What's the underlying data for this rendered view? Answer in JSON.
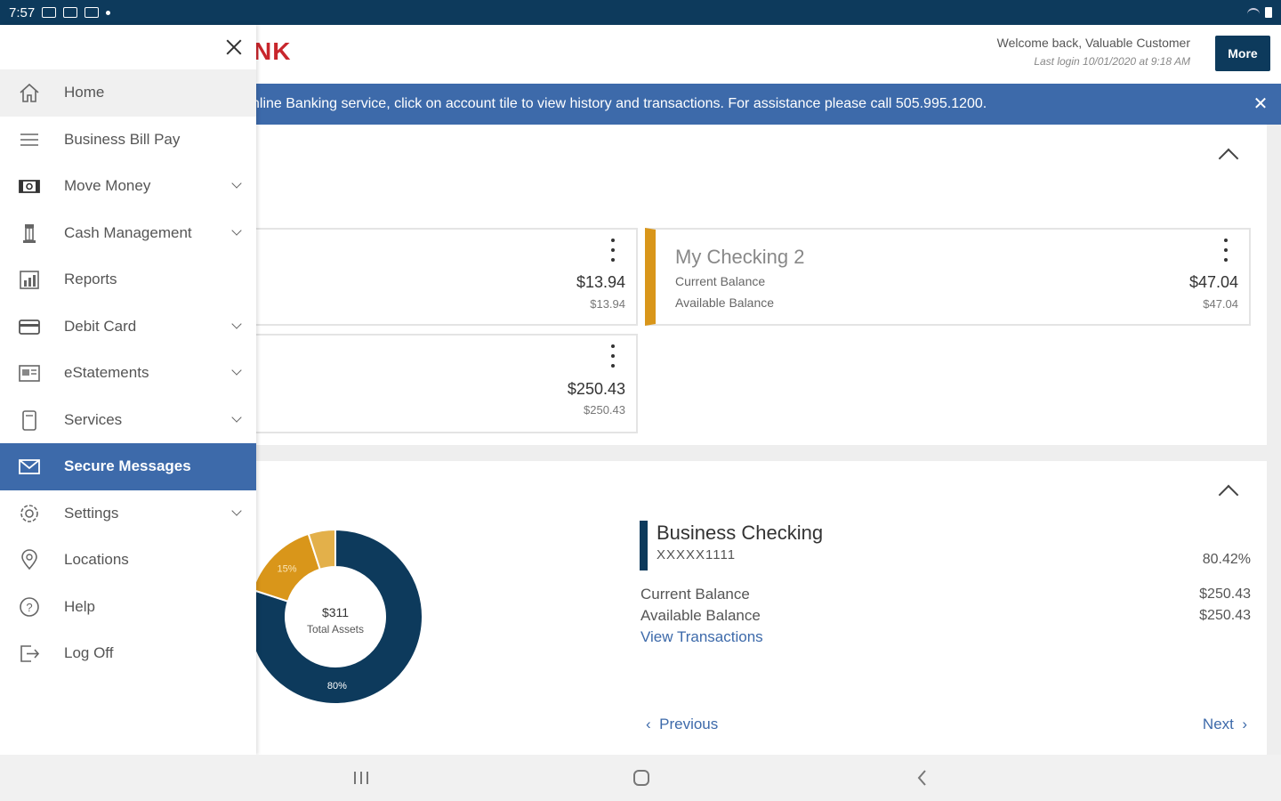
{
  "status_bar": {
    "time": "7:57"
  },
  "header": {
    "logo_text": "NK",
    "welcome": "Welcome back, Valuable Customer",
    "last_login": "Last login 10/01/2020 at 9:18 AM",
    "more_label": "More"
  },
  "banner": {
    "message": "nline Banking service, click on account tile to view history and transactions. For assistance please call 505.995.1200.",
    "close_glyph": "✕"
  },
  "accounts": {
    "tile1": {
      "current": "$13.94",
      "available": "$13.94"
    },
    "tile2": {
      "name": "My Checking 2",
      "current_label": "Current Balance",
      "available_label": "Available Balance",
      "current": "$47.04",
      "available": "$47.04"
    },
    "tile3": {
      "current": "$250.43",
      "available": "$250.43"
    }
  },
  "assets": {
    "total_value": "$311",
    "total_label": "Total Assets",
    "segments": [
      {
        "label": "80%",
        "percent": 80,
        "color": "#0d3a5c"
      },
      {
        "label": "15%",
        "percent": 15,
        "color": "#d9961a"
      },
      {
        "label": "",
        "percent": 5,
        "color": "#e3b04a"
      }
    ],
    "detail": {
      "name": "Business Checking",
      "number": "XXXXX1111",
      "percent": "80.42%",
      "current_label": "Current Balance",
      "current_value": "$250.43",
      "available_label": "Available Balance",
      "available_value": "$250.43",
      "view_label": "View Transactions"
    },
    "previous_label": "Previous",
    "next_label": "Next"
  },
  "sidebar": {
    "items": [
      {
        "label": "Home",
        "icon": "home-icon",
        "expandable": false
      },
      {
        "label": "Business Bill Pay",
        "icon": "list-icon",
        "expandable": false
      },
      {
        "label": "Move Money",
        "icon": "money-icon",
        "expandable": true
      },
      {
        "label": "Cash Management",
        "icon": "bank-building-icon",
        "expandable": true
      },
      {
        "label": "Reports",
        "icon": "bar-chart-icon",
        "expandable": false
      },
      {
        "label": "Debit Card",
        "icon": "card-icon",
        "expandable": true
      },
      {
        "label": "eStatements",
        "icon": "statement-icon",
        "expandable": true
      },
      {
        "label": "Services",
        "icon": "services-icon",
        "expandable": true
      },
      {
        "label": "Secure Messages",
        "icon": "envelope-icon",
        "expandable": false
      },
      {
        "label": "Settings",
        "icon": "gear-icon",
        "expandable": true
      },
      {
        "label": "Locations",
        "icon": "location-pin-icon",
        "expandable": false
      },
      {
        "label": "Help",
        "icon": "help-icon",
        "expandable": false
      },
      {
        "label": "Log Off",
        "icon": "logout-icon",
        "expandable": false
      }
    ]
  },
  "colors": {
    "navy": "#0d3a5c",
    "blue": "#3d6aaa",
    "gold": "#d9961a",
    "red": "#c8262c"
  }
}
